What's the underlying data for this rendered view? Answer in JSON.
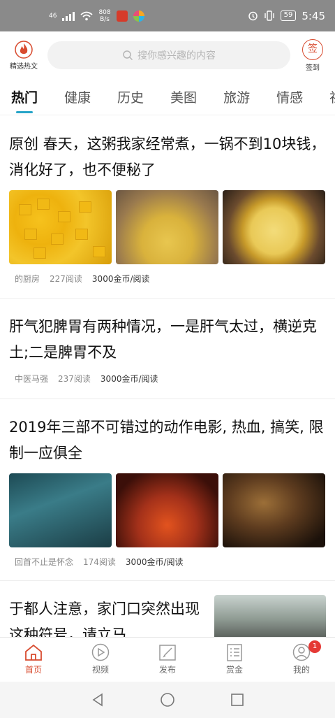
{
  "status_bar": {
    "network": "46",
    "speed": "808\nB/s",
    "battery": "59",
    "time": "5:45",
    "icons": [
      "signal-icon",
      "wifi-icon",
      "alarm-icon",
      "vibrate-icon",
      "battery-icon"
    ]
  },
  "header": {
    "logo_label": "精选热文",
    "search_placeholder": "搜你感兴趣的内容",
    "sign_glyph": "签",
    "sign_label": "签到",
    "accent": "#d84b2f"
  },
  "tabs": [
    "热门",
    "健康",
    "历史",
    "美图",
    "旅游",
    "情感",
    "社会"
  ],
  "articles": [
    {
      "title": "原创 春天，这粥我家经常煮，一锅不到10块钱，消化好了，也不便秘了",
      "author": "的厨房",
      "reads": "227阅读",
      "reward": "3000金币/阅读"
    },
    {
      "title": "肝气犯脾胃有两种情况，一是肝气太过，横逆克土;二是脾胃不及",
      "author": "中医马强",
      "reads": "237阅读",
      "reward": "3000金币/阅读"
    },
    {
      "title": "2019年三部不可错过的动作电影, 热血, 搞笑, 限制一应俱全",
      "author": "回首不止是怀念",
      "reads": "174阅读",
      "reward": "3000金币/阅读"
    },
    {
      "title": "于都人注意，家门口突然出现这种符号，请立马"
    }
  ],
  "bottom_nav": [
    {
      "label": "首页",
      "icon": "home-icon"
    },
    {
      "label": "视频",
      "icon": "play-icon"
    },
    {
      "label": "发布",
      "icon": "edit-icon"
    },
    {
      "label": "赏金",
      "icon": "list-icon"
    },
    {
      "label": "我的",
      "icon": "user-icon",
      "badge": "1"
    }
  ]
}
